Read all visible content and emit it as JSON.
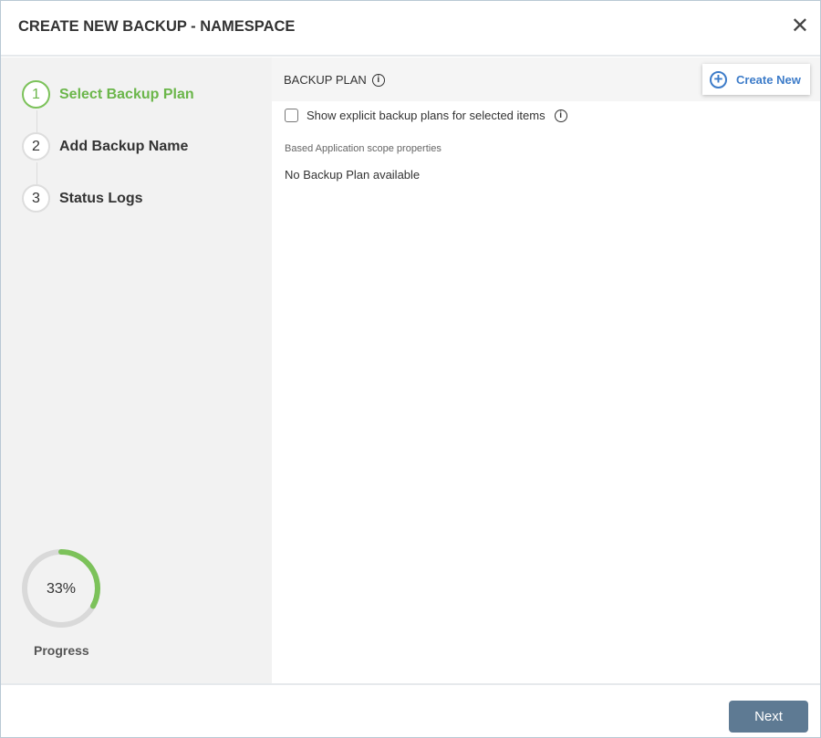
{
  "dialog": {
    "title": "CREATE NEW BACKUP - NAMESPACE",
    "close_icon": "close-icon"
  },
  "steps": [
    {
      "number": "1",
      "label": "Select Backup Plan",
      "state": "active"
    },
    {
      "number": "2",
      "label": "Add Backup Name",
      "state": "pending"
    },
    {
      "number": "3",
      "label": "Status Logs",
      "state": "pending"
    }
  ],
  "progress": {
    "value": 33,
    "text": "33%",
    "label": "Progress",
    "color": "#7cc25a"
  },
  "backup_plan": {
    "title": "BACKUP PLAN",
    "create_new_label": "Create New",
    "checkbox_label": "Show explicit backup plans for selected items",
    "checkbox_checked": false,
    "scope_text": "Based Application scope properties",
    "empty_text": "No Backup Plan available"
  },
  "footer": {
    "next_label": "Next"
  },
  "colors": {
    "accent_green": "#6bb64a",
    "link_blue": "#3d7cc9",
    "button": "#5e7a93"
  }
}
